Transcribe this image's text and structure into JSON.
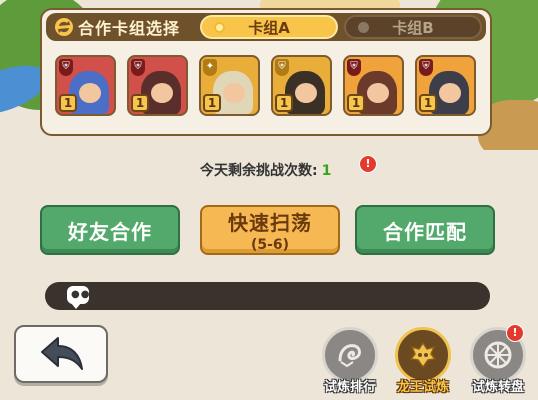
{
  "panel": {
    "title": "合作卡组选择",
    "tab_a": "卡组A",
    "tab_b": "卡组B"
  },
  "cards": [
    {
      "level": "1",
      "color": "red",
      "icon": "defense-shield-icon"
    },
    {
      "level": "1",
      "color": "red",
      "icon": "defense-shield-icon"
    },
    {
      "level": "1",
      "color": "gold",
      "icon": "support-wings-icon"
    },
    {
      "level": "1",
      "color": "gold",
      "icon": "defense-shield-icon"
    },
    {
      "level": "1",
      "color": "orange",
      "icon": "defense-shield-icon"
    },
    {
      "level": "1",
      "color": "orange",
      "icon": "defense-shield-icon"
    }
  ],
  "challenges": {
    "label": "今天剩余挑战次数:",
    "count": "1",
    "alert": "!"
  },
  "buttons": {
    "friend": "好友合作",
    "sweep": "快速扫荡",
    "sweep_range": "(5-6)",
    "match": "合作匹配"
  },
  "bottom": {
    "ranking": "试炼排行",
    "dragon_trial": "龙王试炼",
    "wheel": "试炼转盘",
    "wheel_alert": "!"
  },
  "colors": {
    "accent_gold": "#f8c54a",
    "button_green": "#52a96b",
    "button_yellow": "#f6b852",
    "alert_red": "#e23b2d",
    "count_green": "#38a41d"
  }
}
